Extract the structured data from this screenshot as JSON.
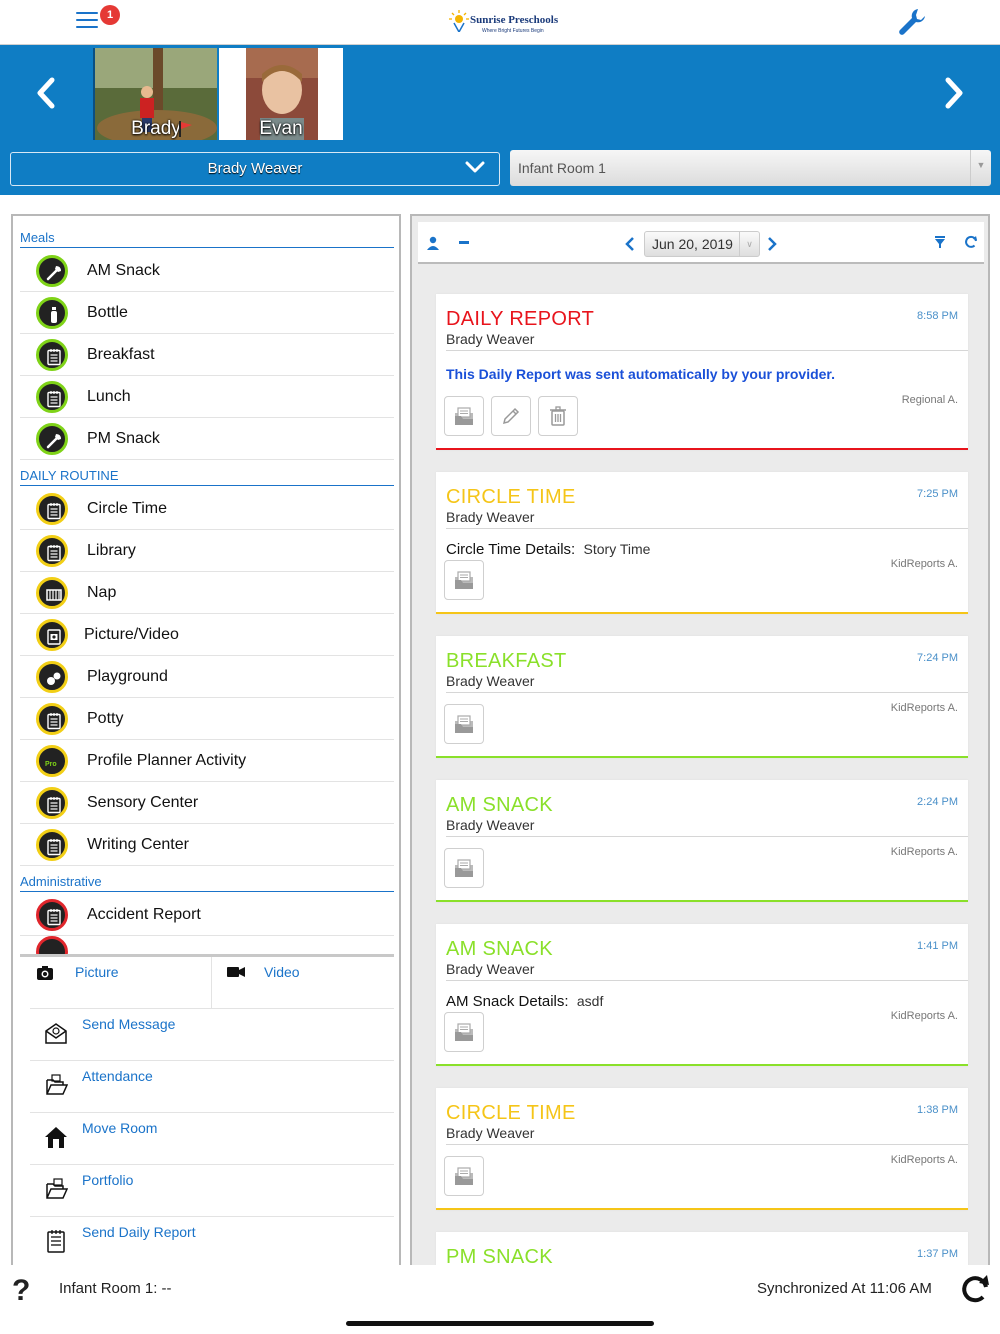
{
  "header": {
    "badge_count": "1",
    "logo": {
      "name": "Sunrise Preschools",
      "tagline": "Where Bright Futures Begin"
    }
  },
  "children": [
    {
      "name": "Brady",
      "selected": true
    },
    {
      "name": "Evan",
      "selected": false
    }
  ],
  "child_select": {
    "value": "Brady Weaver"
  },
  "room_select": {
    "value": "Infant Room 1"
  },
  "activities": {
    "sections": [
      {
        "title": "Meals",
        "items": [
          {
            "label": "AM Snack",
            "icon": "utensils-icon",
            "color": "green"
          },
          {
            "label": "Bottle",
            "icon": "bottle-icon",
            "color": "green"
          },
          {
            "label": "Breakfast",
            "icon": "notepad-icon",
            "color": "green"
          },
          {
            "label": "Lunch",
            "icon": "notepad-icon",
            "color": "green"
          },
          {
            "label": "PM Snack",
            "icon": "utensils-icon",
            "color": "green"
          }
        ]
      },
      {
        "title": "DAILY ROUTINE",
        "items": [
          {
            "label": "Circle Time",
            "icon": "notepad-icon",
            "color": "yellow"
          },
          {
            "label": "Library",
            "icon": "notepad-icon",
            "color": "yellow"
          },
          {
            "label": "Nap",
            "icon": "crib-icon",
            "color": "yellow"
          },
          {
            "label": "Picture/Video",
            "icon": "photo-icon",
            "color": "yellow"
          },
          {
            "label": "Playground",
            "icon": "playground-icon",
            "color": "yellow"
          },
          {
            "label": "Potty",
            "icon": "notepad-icon",
            "color": "yellow"
          },
          {
            "label": "Profile Planner Activity",
            "icon": "profile-planner-icon",
            "color": "yellow"
          },
          {
            "label": "Sensory Center",
            "icon": "notepad-icon",
            "color": "yellow"
          },
          {
            "label": "Writing Center",
            "icon": "notepad-icon",
            "color": "yellow"
          }
        ]
      },
      {
        "title": "Administrative",
        "items": [
          {
            "label": "Accident Report",
            "icon": "notepad-icon",
            "color": "red"
          }
        ]
      }
    ]
  },
  "bottom_actions": {
    "picture": "Picture",
    "video": "Video",
    "send_message": "Send Message",
    "attendance": "Attendance",
    "move_room": "Move Room",
    "portfolio": "Portfolio",
    "send_daily_report": "Send Daily Report"
  },
  "feed_toolbar": {
    "date": "Jun 20, 2019"
  },
  "feed": [
    {
      "title": "DAILY REPORT",
      "time": "8:58 PM",
      "child": "Brady Weaver",
      "note": "This Daily Report was sent automatically by your provider.",
      "author": "Regional A.",
      "color": "#e8141c",
      "buttons": [
        "view",
        "edit",
        "delete"
      ]
    },
    {
      "title": "CIRCLE TIME",
      "time": "7:25 PM",
      "child": "Brady Weaver",
      "detail_label": "Circle Time Details:",
      "detail_value": "Story Time",
      "author": "KidReports A.",
      "color": "#f5c518",
      "buttons": [
        "view"
      ]
    },
    {
      "title": "BREAKFAST",
      "time": "7:24 PM",
      "child": "Brady Weaver",
      "author": "KidReports A.",
      "color": "#8ae02a",
      "buttons": [
        "view"
      ]
    },
    {
      "title": "AM SNACK",
      "time": "2:24 PM",
      "child": "Brady Weaver",
      "author": "KidReports A.",
      "color": "#8ae02a",
      "buttons": [
        "view"
      ]
    },
    {
      "title": "AM SNACK",
      "time": "1:41 PM",
      "child": "Brady Weaver",
      "detail_label": "AM Snack Details:",
      "detail_value": "asdf",
      "author": "KidReports A.",
      "color": "#8ae02a",
      "buttons": [
        "view"
      ]
    },
    {
      "title": "CIRCLE TIME",
      "time": "1:38 PM",
      "child": "Brady Weaver",
      "author": "KidReports A.",
      "color": "#f5c518",
      "buttons": [
        "view"
      ]
    },
    {
      "title": "PM SNACK",
      "time": "1:37 PM",
      "child": "",
      "author": "",
      "color": "#8ae02a",
      "buttons": []
    }
  ],
  "footer": {
    "room_status": "Infant Room 1: --",
    "sync_status": "Synchronized At 11:06 AM"
  },
  "colors": {
    "brand_blue": "#0f7dc4",
    "link_blue": "#1a73c9",
    "green": "#7fd318",
    "yellow": "#f2cf16",
    "red": "#e0262c"
  }
}
